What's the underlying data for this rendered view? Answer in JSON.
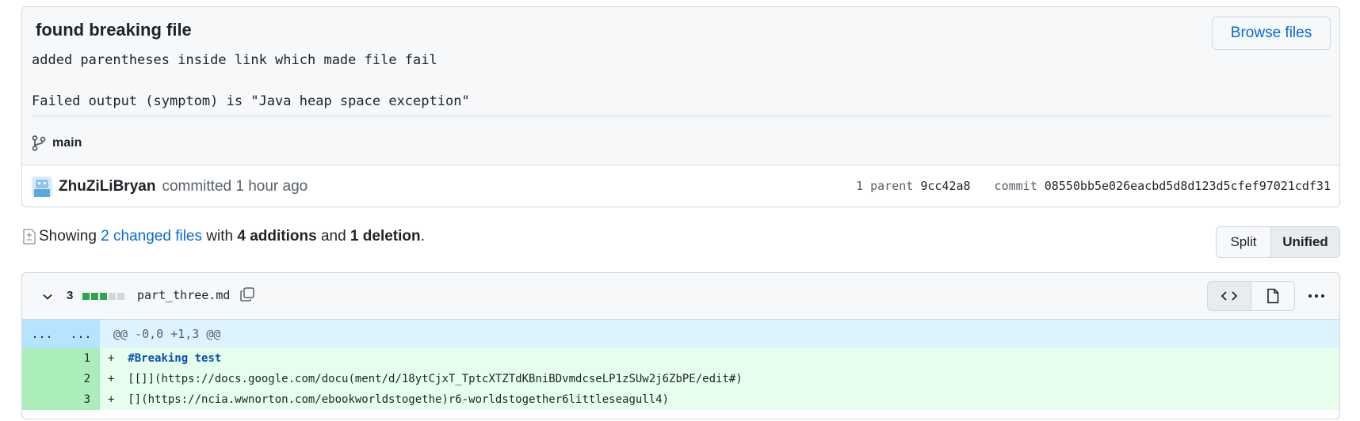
{
  "commit": {
    "title": "found breaking file",
    "message": "added parentheses inside link which made file fail\n\nFailed output (symptom) is \"Java heap space exception\"",
    "browse_label": "Browse files",
    "branch": "main",
    "author": "ZhuZiLiBryan",
    "committed_text": "committed 1 hour ago",
    "parent_label": "1 parent",
    "parent_sha": "9cc42a8",
    "commit_label": "commit",
    "commit_sha": "08550bb5e026eacbd5d8d123d5cfef97021cdf31"
  },
  "summary": {
    "showing": "Showing",
    "changed_files": "2 changed files",
    "with": "with",
    "additions": "4 additions",
    "and": "and",
    "deletions": "1 deletion",
    "period": "."
  },
  "view": {
    "split": "Split",
    "unified": "Unified",
    "active": "Unified"
  },
  "file": {
    "change_count": "3",
    "name": "part_three.md",
    "diff_bar": [
      "add",
      "add",
      "add",
      "neutral",
      "neutral"
    ],
    "hunk_left": "...",
    "hunk_right": "...",
    "hunk_header": "@@ -0,0 +1,3 @@",
    "lines": [
      {
        "num": "1",
        "sign": "+",
        "heading": "#Breaking test",
        "text": ""
      },
      {
        "num": "2",
        "sign": "+",
        "heading": "",
        "text": "[[]](https://docs.google.com/docu(ment/d/18ytCjxT_TptcXTZTdKBniBDvmdcseLP1zSUw2j6ZbPE/edit#)"
      },
      {
        "num": "3",
        "sign": "+",
        "heading": "",
        "text": "[](https://ncia.wwnorton.com/ebookworldstogethe)r6-worldstogether6littleseagull4)"
      }
    ]
  },
  "colors": {
    "link": "#0969da",
    "add_bar": "#2da44e",
    "neutral_bar": "#d0d7de"
  }
}
